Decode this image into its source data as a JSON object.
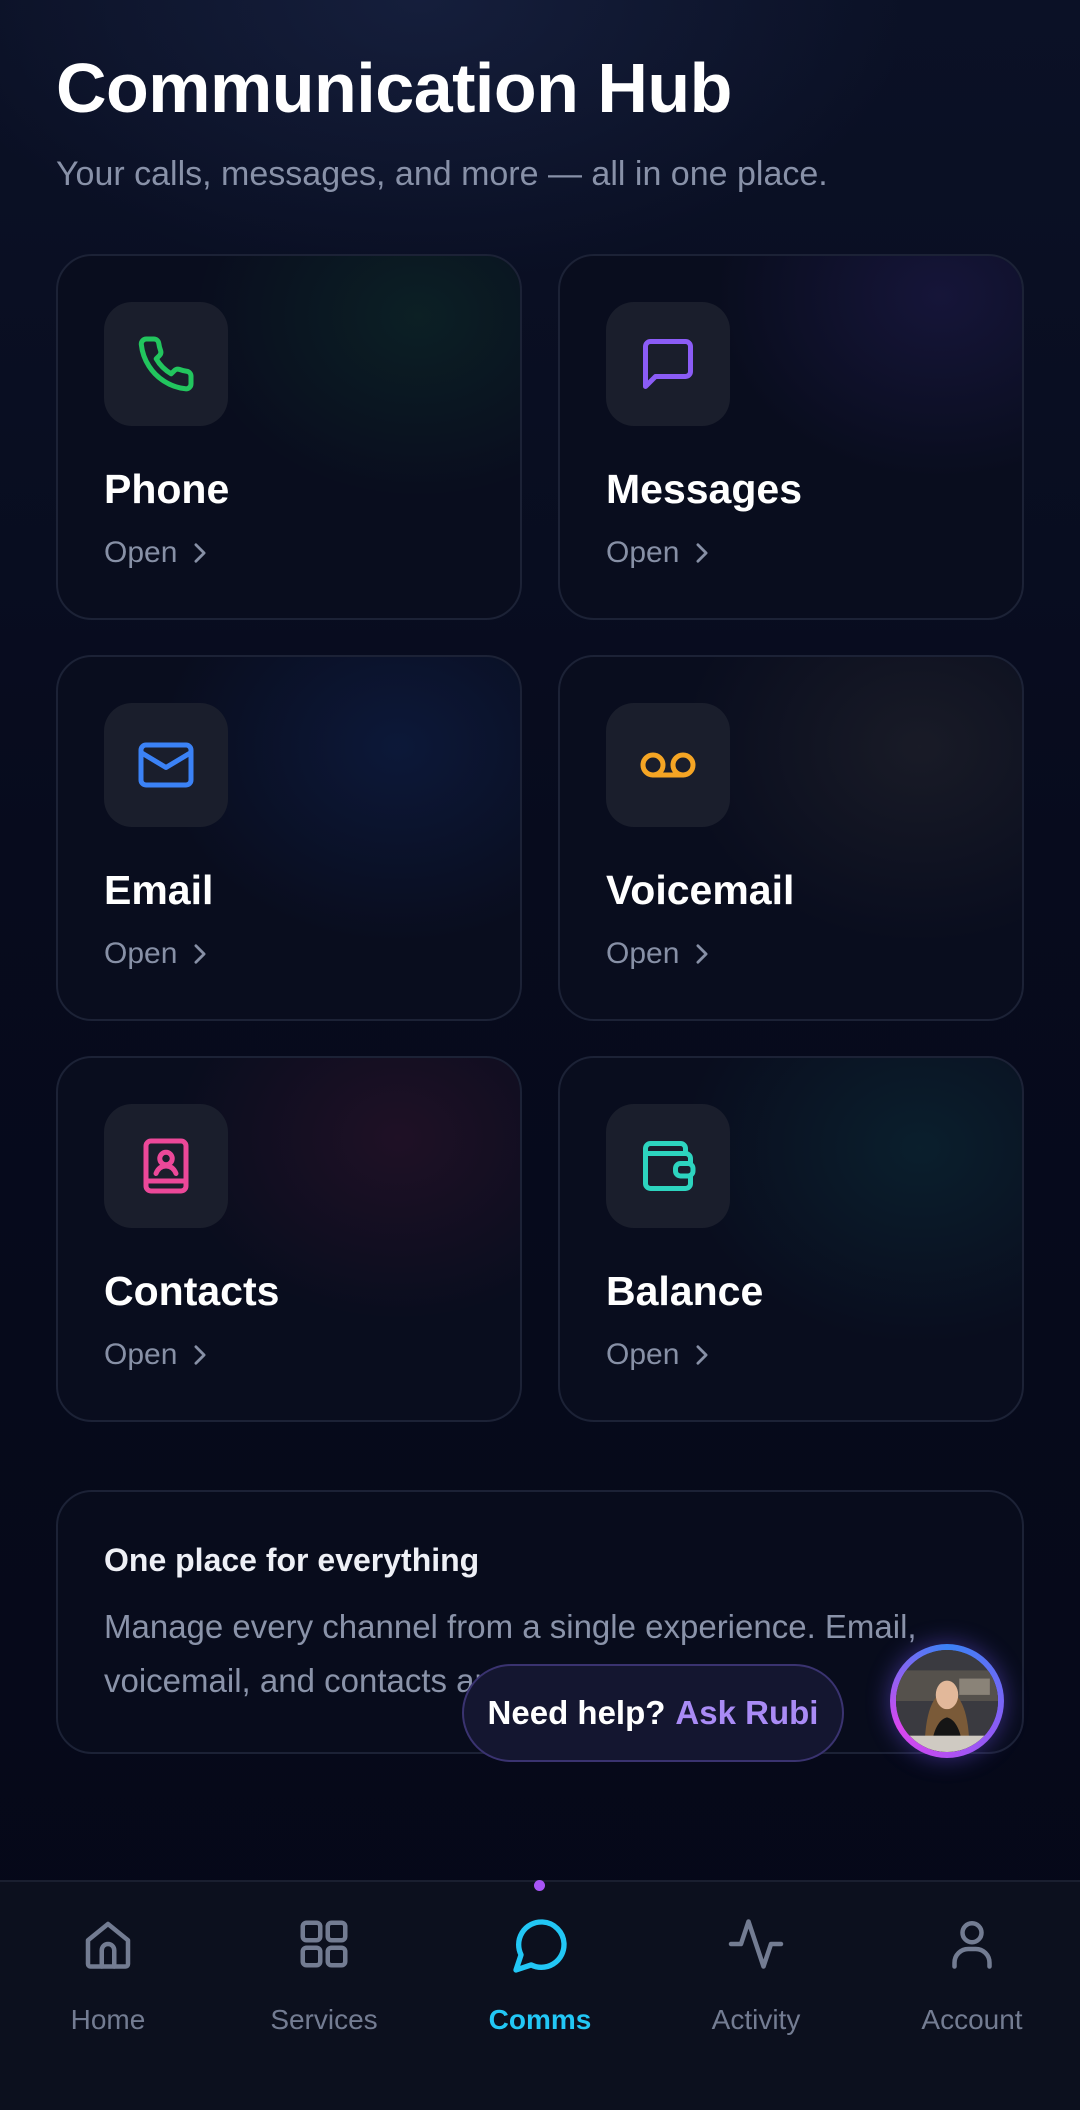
{
  "header": {
    "title": "Communication Hub",
    "subtitle": "Your calls, messages, and more — all in one place."
  },
  "cards": [
    {
      "label": "Phone",
      "action": "Open",
      "icon": "phone-icon",
      "color": "#22c55e"
    },
    {
      "label": "Messages",
      "action": "Open",
      "icon": "message-square-icon",
      "color": "#8b5cf6"
    },
    {
      "label": "Email",
      "action": "Open",
      "icon": "mail-icon",
      "color": "#3b82f6"
    },
    {
      "label": "Voicemail",
      "action": "Open",
      "icon": "voicemail-icon",
      "color": "#f59e0b"
    },
    {
      "label": "Contacts",
      "action": "Open",
      "icon": "contact-book-icon",
      "color": "#ec4899"
    },
    {
      "label": "Balance",
      "action": "Open",
      "icon": "wallet-icon",
      "color": "#2dd4bf"
    }
  ],
  "info": {
    "title": "One place for everything",
    "body": "Manage every channel from a single experience. Email, voicemail, and contacts are all here."
  },
  "help": {
    "question": "Need help?",
    "cta": "Ask Rubi",
    "cta_color": "#a98bf5"
  },
  "nav": {
    "items": [
      {
        "label": "Home",
        "icon": "home-icon"
      },
      {
        "label": "Services",
        "icon": "grid-icon"
      },
      {
        "label": "Comms",
        "icon": "chat-bubble-icon",
        "active": true
      },
      {
        "label": "Activity",
        "icon": "activity-pulse-icon"
      },
      {
        "label": "Account",
        "icon": "user-icon"
      }
    ],
    "active_color": "#22c7f5"
  }
}
